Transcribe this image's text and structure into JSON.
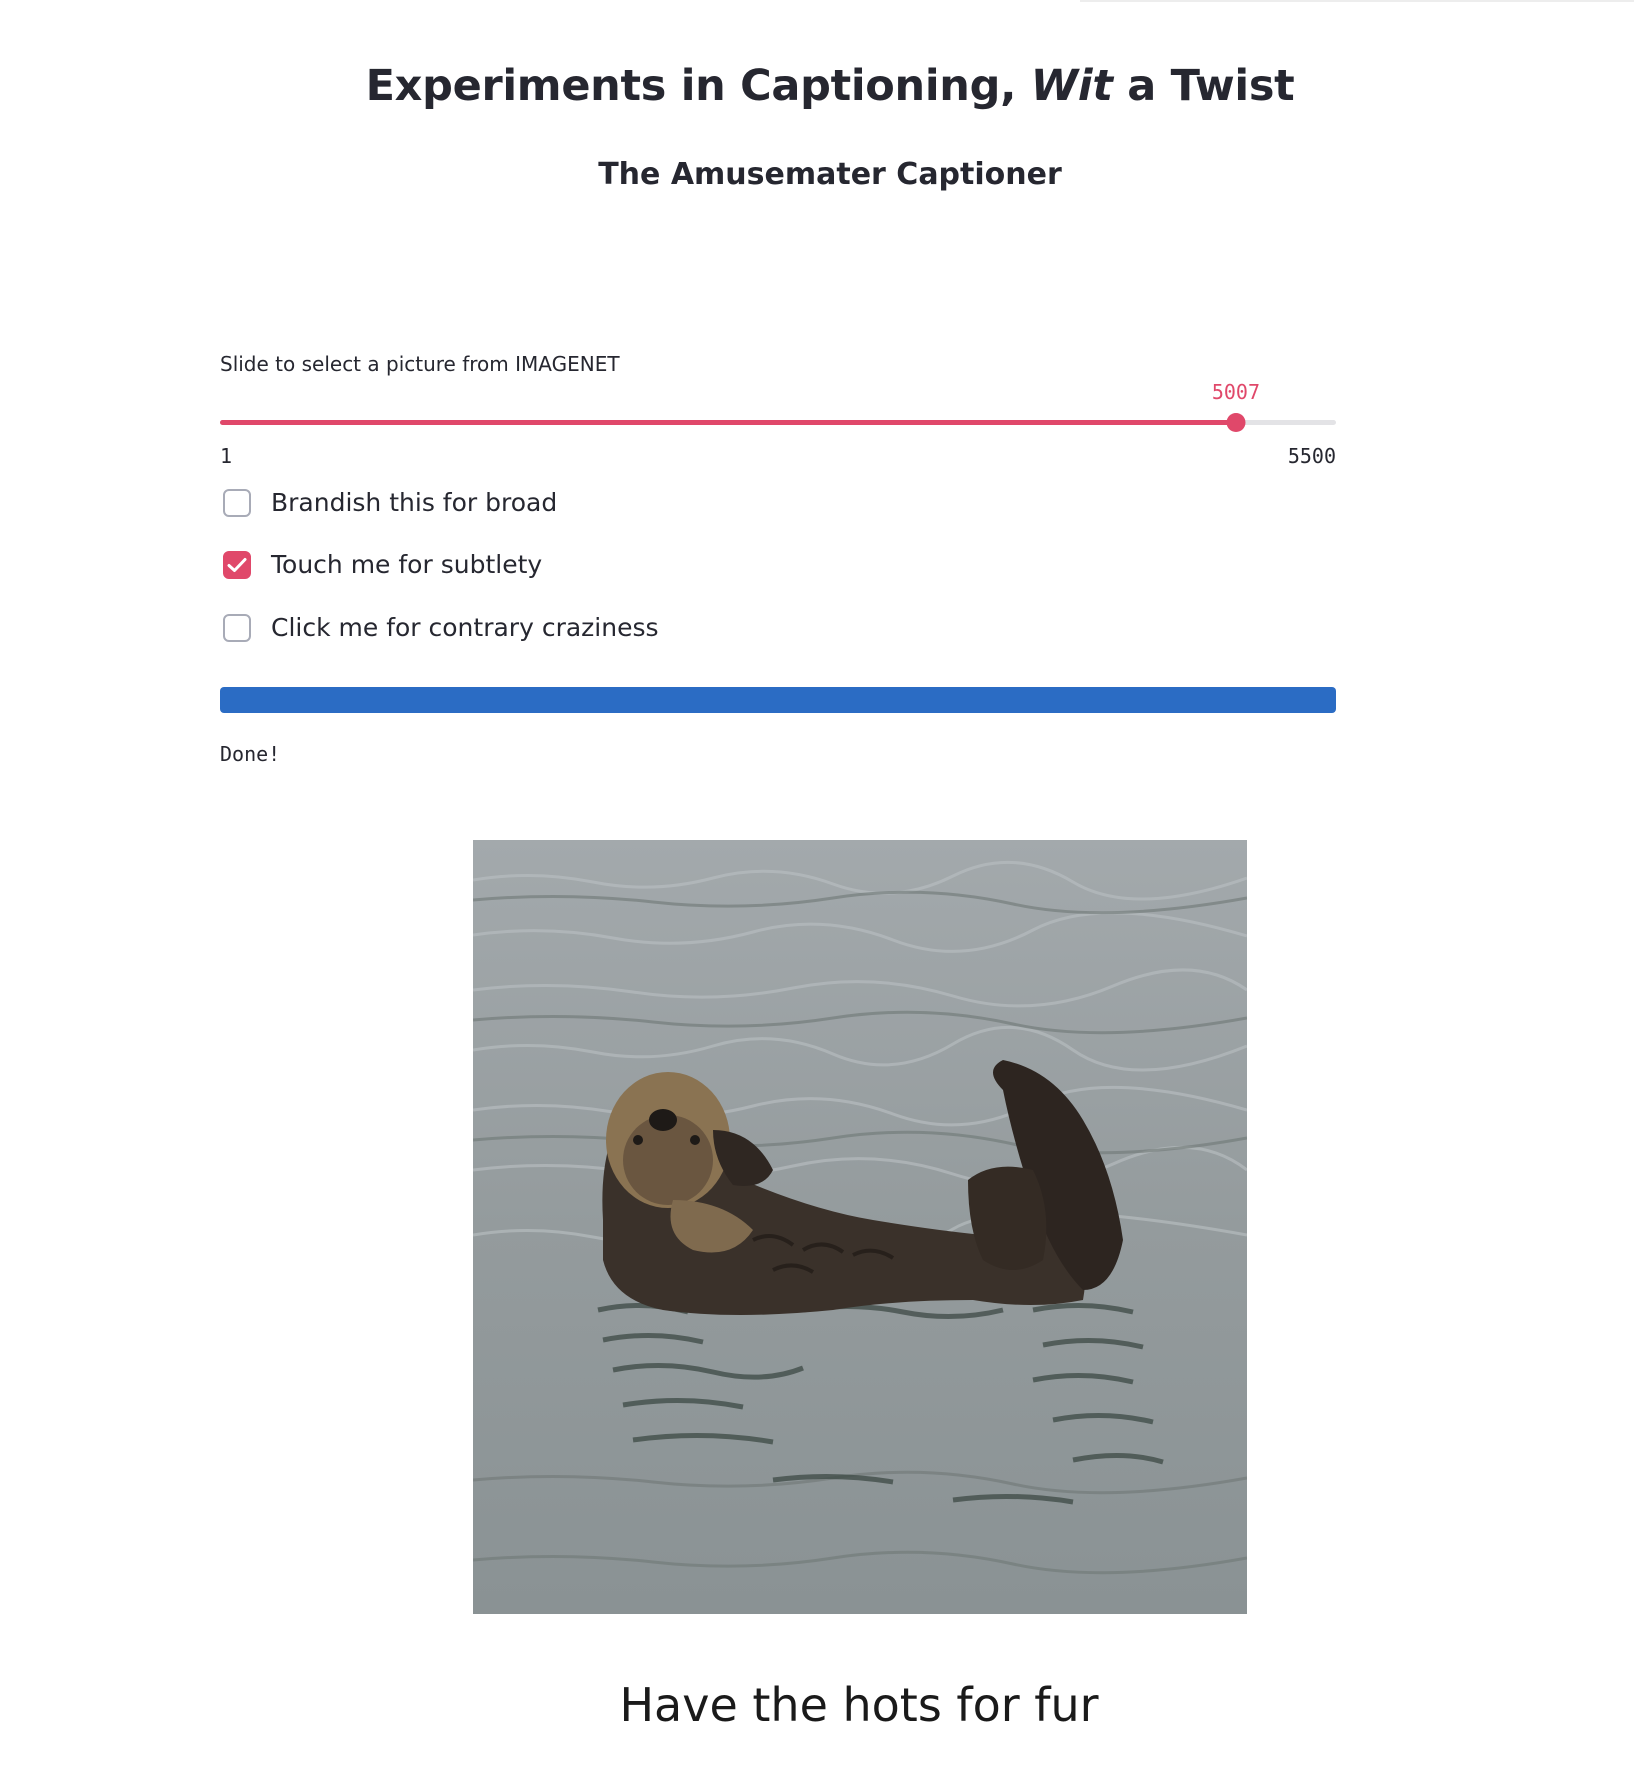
{
  "header": {
    "title_part1": "Experiments in Captioning, ",
    "title_italic": "Wit",
    "title_part2": " a Twist",
    "subtitle": "The Amusemater Captioner"
  },
  "slider": {
    "label": "Slide to select a picture from IMAGENET",
    "value": "5007",
    "min": "1",
    "max": "5500"
  },
  "checkboxes": [
    {
      "label": "Brandish this for broad",
      "checked": false
    },
    {
      "label": "Touch me for subtlety",
      "checked": true
    },
    {
      "label": "Click me for contrary craziness",
      "checked": false
    }
  ],
  "progress": {
    "percent": 100,
    "status": "Done!"
  },
  "image": {
    "icon": "otter-photo"
  },
  "caption": "Have the hots for fur",
  "colors": {
    "accent": "#e0486a",
    "progress": "#2b6cc4",
    "text": "#262730"
  }
}
